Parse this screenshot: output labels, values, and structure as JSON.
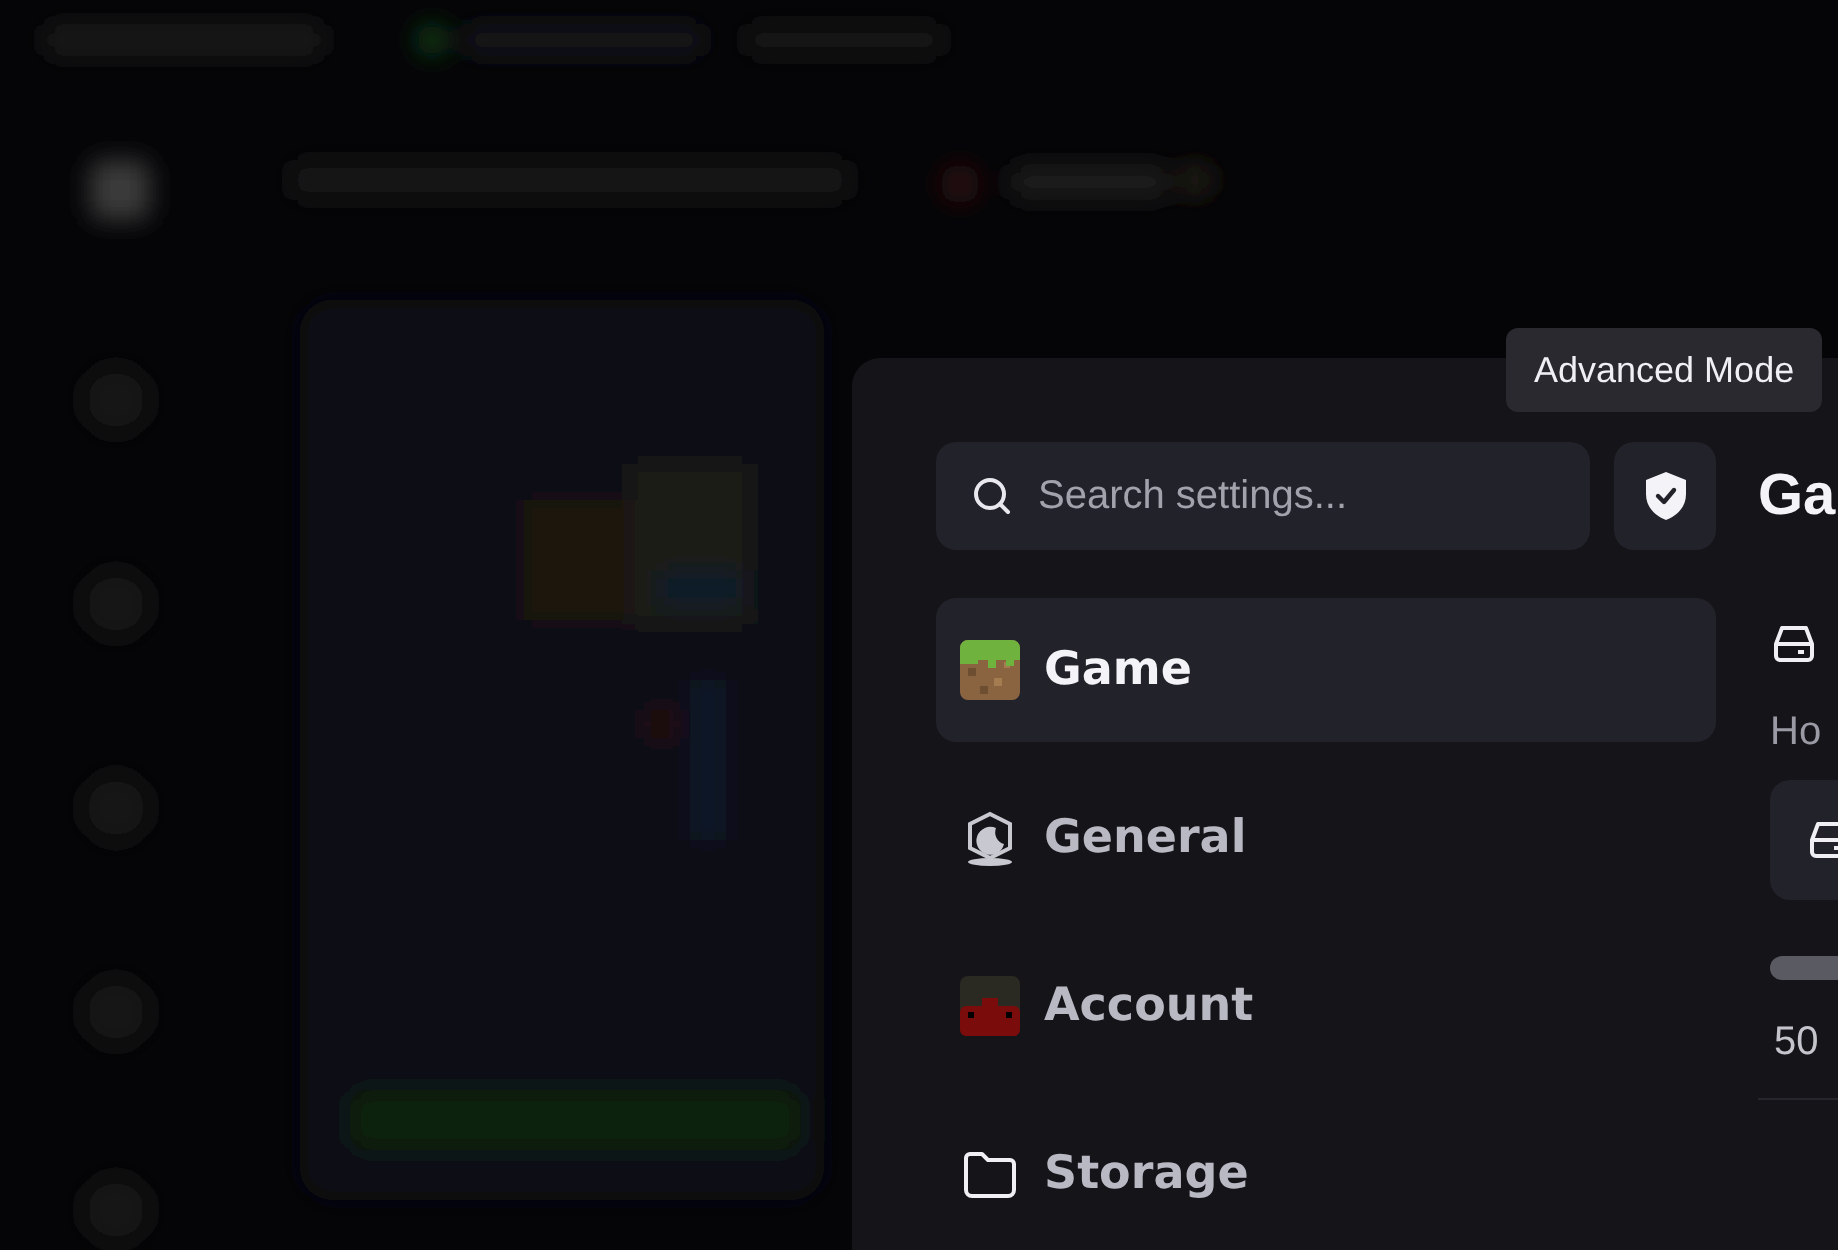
{
  "tooltip": {
    "text": "Advanced Mode"
  },
  "search": {
    "placeholder": "Search settings..."
  },
  "nav": [
    {
      "label": "Game",
      "kind": "grass-block",
      "selected": true
    },
    {
      "label": "General",
      "kind": "moon",
      "selected": false
    },
    {
      "label": "Account",
      "kind": "avatar",
      "selected": false
    },
    {
      "label": "Storage",
      "kind": "folder",
      "selected": false
    }
  ],
  "content": {
    "title": "Ga",
    "description": "Ho",
    "value": "50"
  }
}
